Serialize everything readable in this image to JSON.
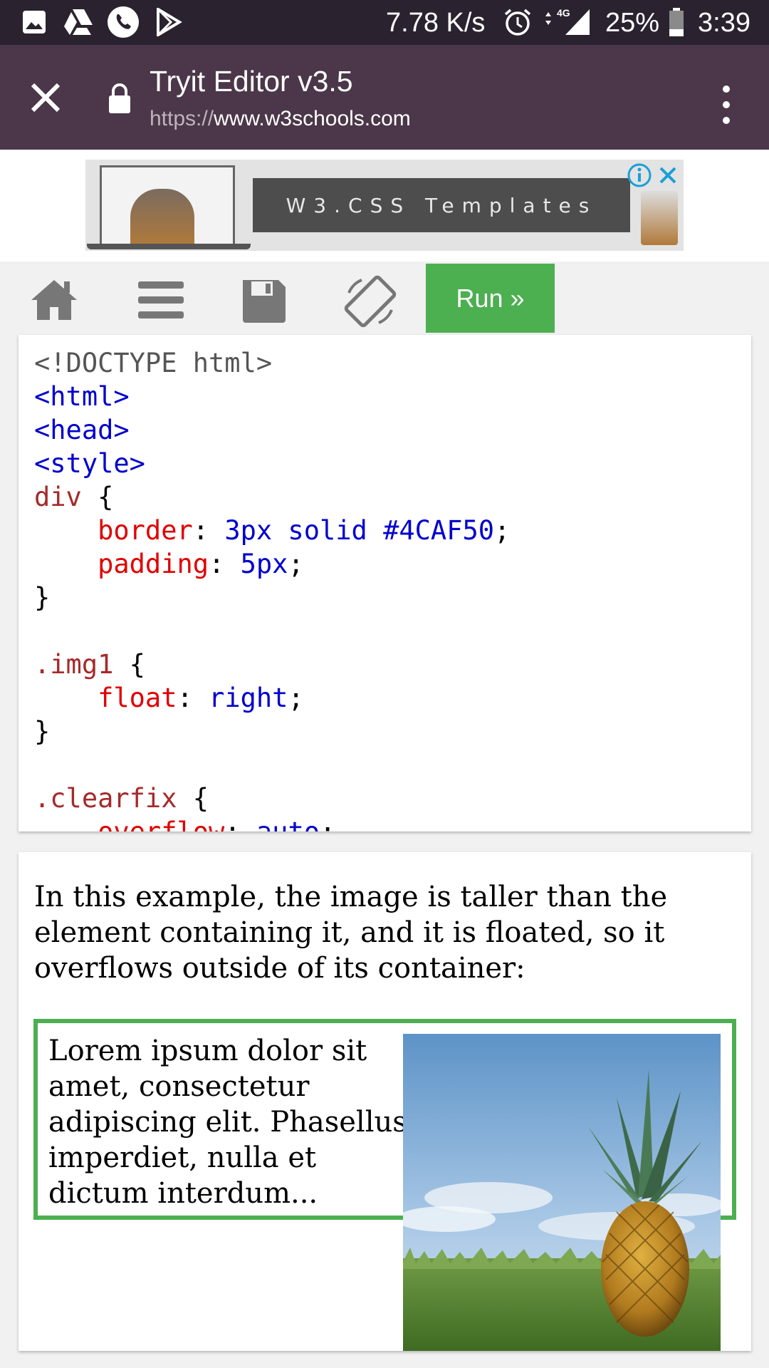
{
  "status_bar": {
    "speed": "7.78 K/s",
    "network": "4G",
    "battery": "25%",
    "time": "3:39"
  },
  "custom_tab": {
    "title": "Tryit Editor v3.5",
    "url_protocol": "https://",
    "url_host": "www.w3schools.com"
  },
  "ad": {
    "banner_text": "W3.CSS Templates"
  },
  "toolbar": {
    "run_label": "Run »"
  },
  "code_lines": [
    "<!DOCTYPE html>",
    "<html>",
    "<head>",
    "<style>",
    "div {",
    "    border: 3px solid #4CAF50;",
    "    padding: 5px;",
    "}",
    "",
    ".img1 {",
    "    float: right;",
    "}",
    "",
    ".clearfix {",
    "    overflow: auto;"
  ],
  "result": {
    "intro": "In this example, the image is taller than the element containing it, and it is floated, so it overflows outside of its container:",
    "lorem": "Lorem ipsum dolor sit amet, consectetur adipiscing elit. Phasellus imperdiet, nulla et dictum interdum..."
  },
  "colors": {
    "status_bar": "#2b2230",
    "tab_bar": "#4b3749",
    "run_button": "#4caf50",
    "border_green": "#4caf50"
  }
}
